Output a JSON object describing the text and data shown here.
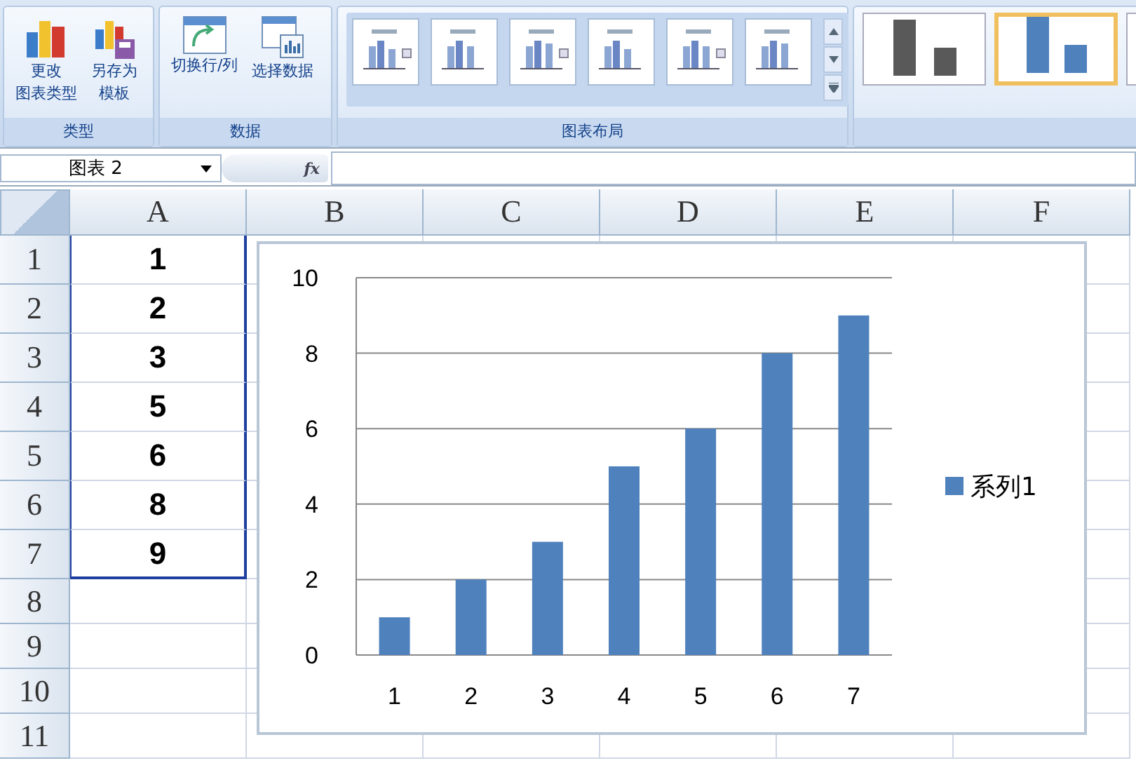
{
  "ribbon": {
    "groups": [
      {
        "label": "类型",
        "buttons": [
          {
            "kind": "chart-type",
            "lines": [
              "更改",
              "图表类型"
            ]
          },
          {
            "kind": "save-template",
            "lines": [
              "另存为",
              "模板"
            ]
          }
        ]
      },
      {
        "label": "数据",
        "buttons": [
          {
            "kind": "switch",
            "lines": [
              "切换行/列"
            ]
          },
          {
            "kind": "select-data",
            "lines": [
              "选择数据"
            ]
          }
        ]
      },
      {
        "label": "图表布局",
        "kind": "layouts"
      },
      {
        "kind": "styles",
        "styles": [
          {
            "color": "#595959",
            "selected": false
          },
          {
            "color": "#4f81bd",
            "selected": true
          }
        ]
      }
    ]
  },
  "formula_bar": {
    "name_box": "图表 2",
    "fx": "fx"
  },
  "sheet": {
    "columns": [
      "A",
      "B",
      "C",
      "D",
      "E",
      "F"
    ],
    "rows": [
      "1",
      "2",
      "3",
      "4",
      "5",
      "6",
      "7",
      "8",
      "9",
      "10",
      "11"
    ],
    "column_a": [
      "1",
      "2",
      "3",
      "5",
      "6",
      "8",
      "9"
    ]
  },
  "chart": {
    "chart_data": {
      "type": "bar",
      "grid": true,
      "categories": [
        "1",
        "2",
        "3",
        "4",
        "5",
        "6",
        "7"
      ],
      "series": [
        {
          "name": "系列1",
          "color": "#4f81bd",
          "values": [
            1,
            2,
            3,
            5,
            6,
            8,
            9
          ]
        }
      ],
      "ylim": [
        0,
        10
      ],
      "yticks": [
        0,
        2,
        4,
        6,
        8,
        10
      ]
    }
  }
}
